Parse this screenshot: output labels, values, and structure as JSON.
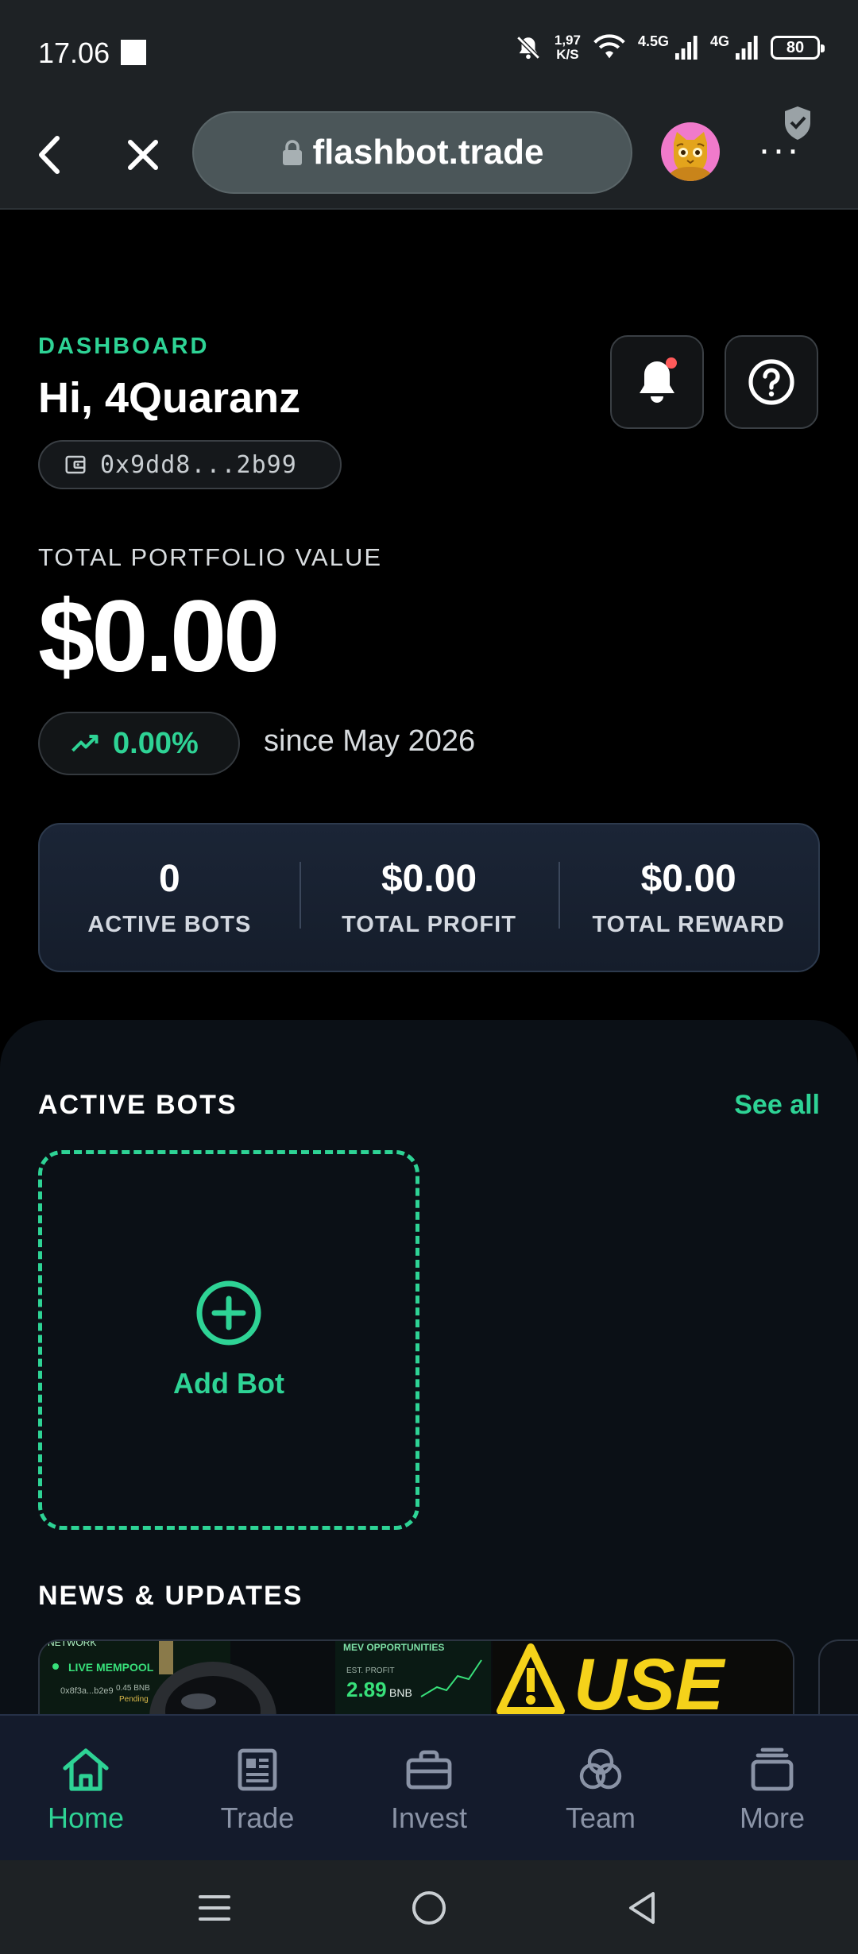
{
  "status_bar": {
    "time": "17.06",
    "net_speed_value": "1,97",
    "net_speed_unit": "K/S",
    "signal1_label": "4.5G",
    "signal2_label": "4G",
    "battery": "80"
  },
  "browser": {
    "url": "flashbot.trade"
  },
  "header": {
    "section_label": "DASHBOARD",
    "greeting": "Hi, 4Quaranz",
    "wallet_address": "0x9dd8...2b99"
  },
  "portfolio": {
    "label": "TOTAL PORTFOLIO VALUE",
    "value": "$0.00",
    "change": "0.00%",
    "since": "since May 2026"
  },
  "stats": [
    {
      "value": "0",
      "label": "ACTIVE BOTS"
    },
    {
      "value": "$0.00",
      "label": "TOTAL PROFIT"
    },
    {
      "value": "$0.00",
      "label": "TOTAL REWARD"
    }
  ],
  "active_bots": {
    "title": "ACTIVE BOTS",
    "see_all": "See all",
    "add_bot": "Add Bot"
  },
  "news": {
    "title": "NEWS & UPDATES",
    "banner": {
      "network_text": "NETWORK",
      "mempool_text": "LIVE MEMPOOL",
      "tx_text": "0x8f3a...b2e9",
      "bnb_small": "0.45 BNB",
      "pending": "Pending",
      "mev_text": "MEV OPPORTUNITIES",
      "est_profit": "EST. PROFIT",
      "profit_value": "2.89",
      "profit_unit": "BNB",
      "warning_text": "USE"
    }
  },
  "bottom_nav": {
    "items": [
      {
        "label": "Home",
        "icon": "home-icon",
        "active": true
      },
      {
        "label": "Trade",
        "icon": "newspaper-icon",
        "active": false
      },
      {
        "label": "Invest",
        "icon": "briefcase-icon",
        "active": false
      },
      {
        "label": "Team",
        "icon": "team-circles-icon",
        "active": false
      },
      {
        "label": "More",
        "icon": "stack-icon",
        "active": false
      }
    ]
  },
  "colors": {
    "accent": "#2ed395",
    "background": "#000000",
    "panel": "#0b1016",
    "nav_background": "#141b2c",
    "browser_bar": "#1e2225"
  }
}
